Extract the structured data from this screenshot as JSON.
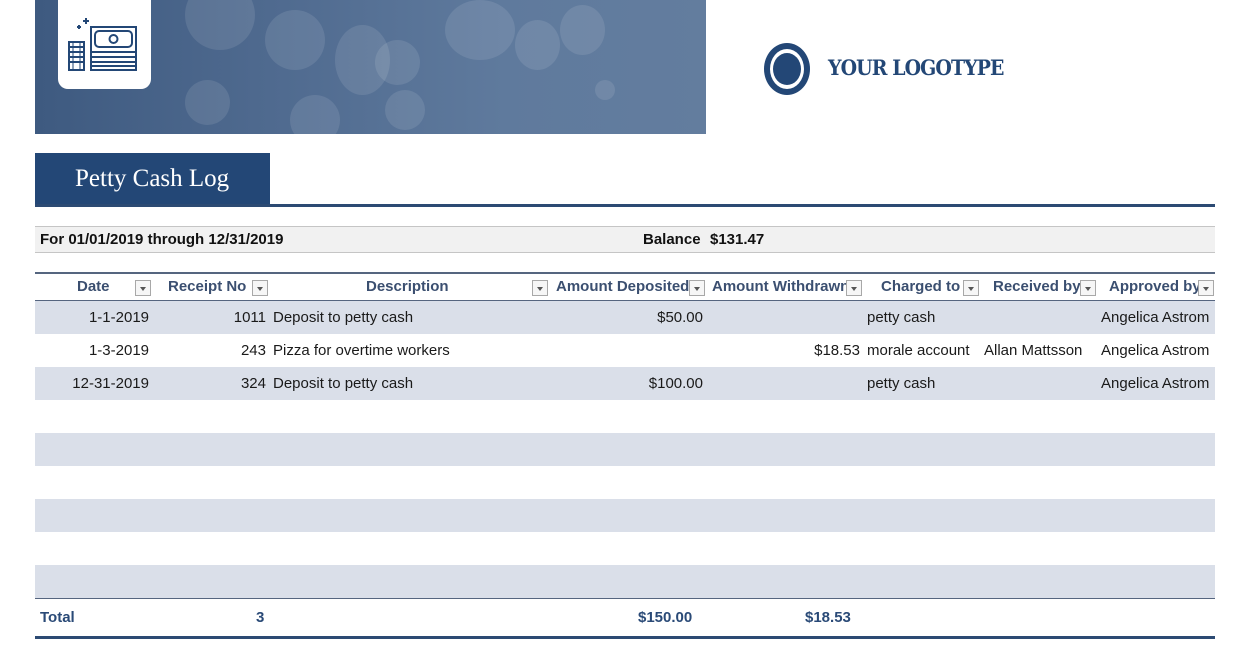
{
  "banner": {
    "icon": "money-stack-icon"
  },
  "logo": {
    "icon": "ring-logo-icon",
    "text": "YOUR LOGOTYPE"
  },
  "title": "Petty Cash Log",
  "period": {
    "text": "For 01/01/2019 through 12/31/2019",
    "balance_label": "Balance",
    "balance_value": "$131.47"
  },
  "colors": {
    "primary": "#234776",
    "band": "#dadfe9",
    "header_text": "#3b4f70"
  },
  "table": {
    "columns": [
      {
        "label": "Date",
        "filter_icon": "dropdown-arrow-icon"
      },
      {
        "label": "Receipt No",
        "filter_icon": "dropdown-arrow-icon"
      },
      {
        "label": "Description",
        "filter_icon": "dropdown-arrow-icon"
      },
      {
        "label": "Amount Deposited",
        "filter_icon": "dropdown-arrow-icon"
      },
      {
        "label": "Amount Withdrawn",
        "filter_icon": "dropdown-arrow-icon"
      },
      {
        "label": "Charged to",
        "filter_icon": "dropdown-arrow-icon"
      },
      {
        "label": "Received by",
        "filter_icon": "dropdown-arrow-icon"
      },
      {
        "label": "Approved by",
        "filter_icon": "dropdown-arrow-icon"
      }
    ],
    "rows": [
      {
        "date": "1-1-2019",
        "receipt": "1011",
        "description": "Deposit to petty cash",
        "deposited": "$50.00",
        "withdrawn": "",
        "charged_to": "petty cash",
        "received_by": "",
        "approved_by": "Angelica Astrom"
      },
      {
        "date": "1-3-2019",
        "receipt": "243",
        "description": "Pizza for overtime workers",
        "deposited": "",
        "withdrawn": "$18.53",
        "charged_to": "morale account",
        "received_by": "Allan Mattsson",
        "approved_by": "Angelica Astrom"
      },
      {
        "date": "12-31-2019",
        "receipt": "324",
        "description": "Deposit to petty cash",
        "deposited": "$100.00",
        "withdrawn": "",
        "charged_to": "petty cash",
        "received_by": "",
        "approved_by": "Angelica Astrom"
      },
      {
        "date": "",
        "receipt": "",
        "description": "",
        "deposited": "",
        "withdrawn": "",
        "charged_to": "",
        "received_by": "",
        "approved_by": ""
      },
      {
        "date": "",
        "receipt": "",
        "description": "",
        "deposited": "",
        "withdrawn": "",
        "charged_to": "",
        "received_by": "",
        "approved_by": ""
      },
      {
        "date": "",
        "receipt": "",
        "description": "",
        "deposited": "",
        "withdrawn": "",
        "charged_to": "",
        "received_by": "",
        "approved_by": ""
      },
      {
        "date": "",
        "receipt": "",
        "description": "",
        "deposited": "",
        "withdrawn": "",
        "charged_to": "",
        "received_by": "",
        "approved_by": ""
      },
      {
        "date": "",
        "receipt": "",
        "description": "",
        "deposited": "",
        "withdrawn": "",
        "charged_to": "",
        "received_by": "",
        "approved_by": ""
      },
      {
        "date": "",
        "receipt": "",
        "description": "",
        "deposited": "",
        "withdrawn": "",
        "charged_to": "",
        "received_by": "",
        "approved_by": ""
      }
    ],
    "total": {
      "label": "Total",
      "count": "3",
      "deposited": "$150.00",
      "withdrawn": "$18.53"
    }
  }
}
